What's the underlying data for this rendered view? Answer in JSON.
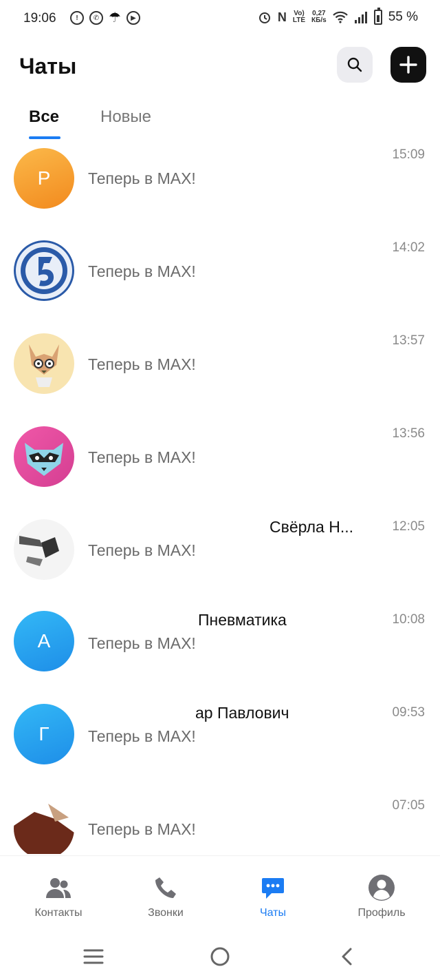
{
  "status_bar": {
    "time": "19:06",
    "net_speed_value": "0,27",
    "net_speed_unit": "КБ/s",
    "net_type_top": "Vo)",
    "net_type_bottom": "LTE",
    "battery_pct": "55 %"
  },
  "header": {
    "title": "Чаты"
  },
  "tabs": [
    {
      "label": "Все",
      "active": true
    },
    {
      "label": "Новые",
      "active": false
    }
  ],
  "chats": [
    {
      "name": "",
      "message": "Теперь в MAX!",
      "time": "15:09",
      "avatar_letter": "Р",
      "avatar_color": "#f7a634"
    },
    {
      "name": "",
      "message": "Теперь в MAX!",
      "time": "14:02",
      "avatar_letter": "",
      "avatar_color": "#2a5aa8"
    },
    {
      "name": "",
      "message": "Теперь в MAX!",
      "time": "13:57",
      "avatar_letter": "",
      "avatar_color": "#f6dfa6"
    },
    {
      "name": "",
      "message": "Теперь в MAX!",
      "time": "13:56",
      "avatar_letter": "",
      "avatar_color": "#e84ea0"
    },
    {
      "name": "Свёрла Н...",
      "message": "Теперь в MAX!",
      "time": "12:05",
      "avatar_letter": "",
      "avatar_color": "#f2f2f2"
    },
    {
      "name": "Пневматика",
      "message": "Теперь в MAX!",
      "time": "10:08",
      "avatar_letter": "А",
      "avatar_color": "#2aa8f0"
    },
    {
      "name": "ар Павлович",
      "message": "Теперь в MAX!",
      "time": "09:53",
      "avatar_letter": "Г",
      "avatar_color": "#2aa8f0"
    },
    {
      "name": "",
      "message": "Теперь в MAX!",
      "time": "07:05",
      "avatar_letter": "",
      "avatar_color": "#6b2a1a"
    }
  ],
  "bottom_nav": [
    {
      "label": "Контакты",
      "icon": "contacts-icon",
      "active": false
    },
    {
      "label": "Звонки",
      "icon": "phone-icon",
      "active": false
    },
    {
      "label": "Чаты",
      "icon": "chat-icon",
      "active": true
    },
    {
      "label": "Профиль",
      "icon": "profile-icon",
      "active": false
    }
  ],
  "colors": {
    "accent": "#1b7cf3",
    "text_primary": "#111111",
    "text_secondary": "#6b6b6b"
  }
}
